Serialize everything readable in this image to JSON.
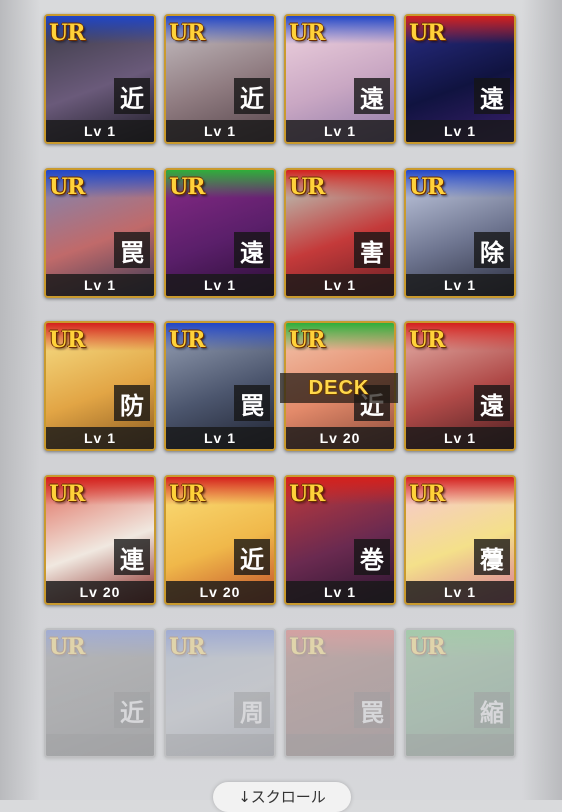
{
  "colors": {
    "frame_gold": "#c99a2e",
    "rarity_text": "#ffd23a",
    "deck_text": "#ffd84a",
    "band_blue": "#2146c7",
    "band_red": "#d4201c",
    "band_green": "#2fae3a"
  },
  "cards": [
    {
      "rarity": "UR",
      "type": "近",
      "level": "Lv 1",
      "band": "blue",
      "art": [
        "#3a3a44",
        "#6a5a7a",
        "#1d1b26"
      ],
      "dim": false
    },
    {
      "rarity": "UR",
      "type": "近",
      "level": "Lv 1",
      "band": "blue",
      "art": [
        "#c9c3c6",
        "#8f7b80",
        "#56454b"
      ],
      "dim": false
    },
    {
      "rarity": "UR",
      "type": "遠",
      "level": "Lv 1",
      "band": "blue",
      "art": [
        "#f1d5e0",
        "#c9a7c3",
        "#8f7aa8"
      ],
      "dim": false
    },
    {
      "rarity": "UR",
      "type": "遠",
      "level": "Lv 1",
      "band": "red",
      "art": [
        "#2a2f8a",
        "#101340",
        "#3a1f6a"
      ],
      "dim": false
    },
    {
      "rarity": "UR",
      "type": "罠",
      "level": "Lv 1",
      "band": "blue",
      "art": [
        "#7a88b8",
        "#c06a6a",
        "#3a3a55"
      ],
      "dim": false
    },
    {
      "rarity": "UR",
      "type": "遠",
      "level": "Lv 1",
      "band": "green",
      "art": [
        "#8a2a88",
        "#5a1f6a",
        "#2b0e35"
      ],
      "dim": false
    },
    {
      "rarity": "UR",
      "type": "害",
      "level": "Lv 1",
      "band": "red",
      "art": [
        "#b7d8c9",
        "#c43a3a",
        "#6a2025"
      ],
      "dim": false
    },
    {
      "rarity": "UR",
      "type": "除",
      "level": "Lv 1",
      "band": "blue",
      "art": [
        "#c8d0e6",
        "#6e7590",
        "#2a2d3e"
      ],
      "dim": false
    },
    {
      "rarity": "UR",
      "type": "防",
      "level": "Lv 1",
      "band": "red",
      "art": [
        "#f7e28a",
        "#e2a545",
        "#8a5a20"
      ],
      "dim": false
    },
    {
      "rarity": "UR",
      "type": "罠",
      "level": "Lv 1",
      "band": "blue",
      "art": [
        "#9aa4b8",
        "#4c566e",
        "#1e2230"
      ],
      "dim": false
    },
    {
      "rarity": "UR",
      "type": "近",
      "level": "Lv 20",
      "band": "green",
      "art": [
        "#f4c8b0",
        "#e38a6a",
        "#8a4a3a"
      ],
      "dim": false
    },
    {
      "rarity": "UR",
      "type": "遠",
      "level": "Lv 1",
      "band": "red",
      "art": [
        "#e8b8b0",
        "#b04a48",
        "#4a1e20"
      ],
      "dim": false
    },
    {
      "rarity": "UR",
      "type": "連",
      "level": "Lv 20",
      "band": "red",
      "art": [
        "#e06a5a",
        "#f0e8e0",
        "#8a2a25"
      ],
      "dim": false
    },
    {
      "rarity": "UR",
      "type": "近",
      "level": "Lv 20",
      "band": "red",
      "art": [
        "#fbe07a",
        "#f0b84a",
        "#c2502a"
      ],
      "dim": false
    },
    {
      "rarity": "UR",
      "type": "巻",
      "level": "Lv 1",
      "band": "red",
      "art": [
        "#c43a3a",
        "#6a2a50",
        "#2a1530"
      ],
      "dim": false
    },
    {
      "rarity": "UR",
      "type": "蘉",
      "level": "Lv 1",
      "band": "red",
      "art": [
        "#f7c6d6",
        "#f4e08a",
        "#d97a9a"
      ],
      "dim": false
    },
    {
      "rarity": "UR",
      "type": "近",
      "level": "",
      "band": "blue",
      "art": [
        "#6a6a6a",
        "#4a4a4a",
        "#2a2a2a"
      ],
      "dim": true
    },
    {
      "rarity": "UR",
      "type": "周",
      "level": "",
      "band": "blue",
      "art": [
        "#7a8fb0",
        "#9aa0aa",
        "#5a6070"
      ],
      "dim": true
    },
    {
      "rarity": "UR",
      "type": "罠",
      "level": "",
      "band": "red",
      "art": [
        "#8a3a2a",
        "#5a2520",
        "#3a1815"
      ],
      "dim": true
    },
    {
      "rarity": "UR",
      "type": "縮",
      "level": "",
      "band": "green",
      "art": [
        "#5aa05a",
        "#3a7a4a",
        "#2a4a30"
      ],
      "dim": true
    }
  ],
  "deck_label": "DECK",
  "scroll_hint": "↓スクロール"
}
